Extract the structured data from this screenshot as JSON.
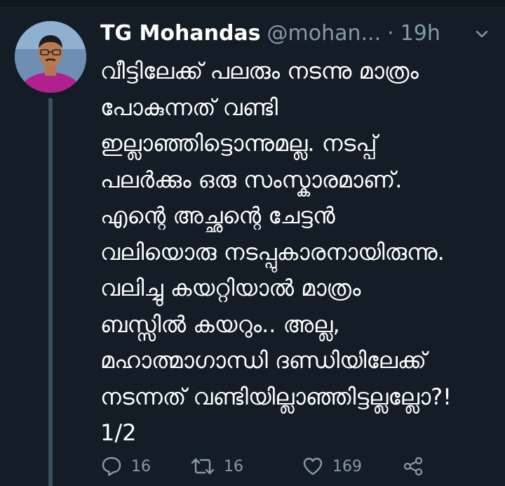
{
  "tweet": {
    "author": {
      "display_name": "TG Mohandas",
      "handle": "@mohan...",
      "separator": "·",
      "time": "19h"
    },
    "lines": [
      "വീട്ടിലേക്ക് പലരും നടന്നു മാത്രം",
      "പോകുന്നത് വണ്ടി",
      "ഇല്ലാഞ്ഞിട്ടൊന്നുമല്ല. നടപ്പ്",
      "പലർക്കും ഒരു സംസ്കാരമാണ്.",
      "എന്റെ അച്ഛന്റെ ചേട്ടൻ",
      "വലിയൊരു നടപ്പുകാരനായിരുന്നു.",
      "വലിച്ചു കയറ്റിയാൽ മാത്രം",
      "ബസ്സിൽ കയറും..   അല്ല,",
      "മഹാത്മാഗാന്ധി ദണ്ഡിയിലേക്ക്",
      "നടന്നത് വണ്ടിയില്ലാഞ്ഞിട്ടല്ലല്ലോ?!",
      "1/2"
    ],
    "actions": {
      "reply_count": "16",
      "retweet_count": "16",
      "like_count": "169"
    }
  },
  "icons": {
    "reply": "reply-icon",
    "retweet": "retweet-icon",
    "like": "heart-icon",
    "share": "share-icon",
    "menu": "chevron-down-icon"
  },
  "colors": {
    "background": "#141d26",
    "muted_text": "#8899a6",
    "thread_line": "#3d4d5c"
  }
}
